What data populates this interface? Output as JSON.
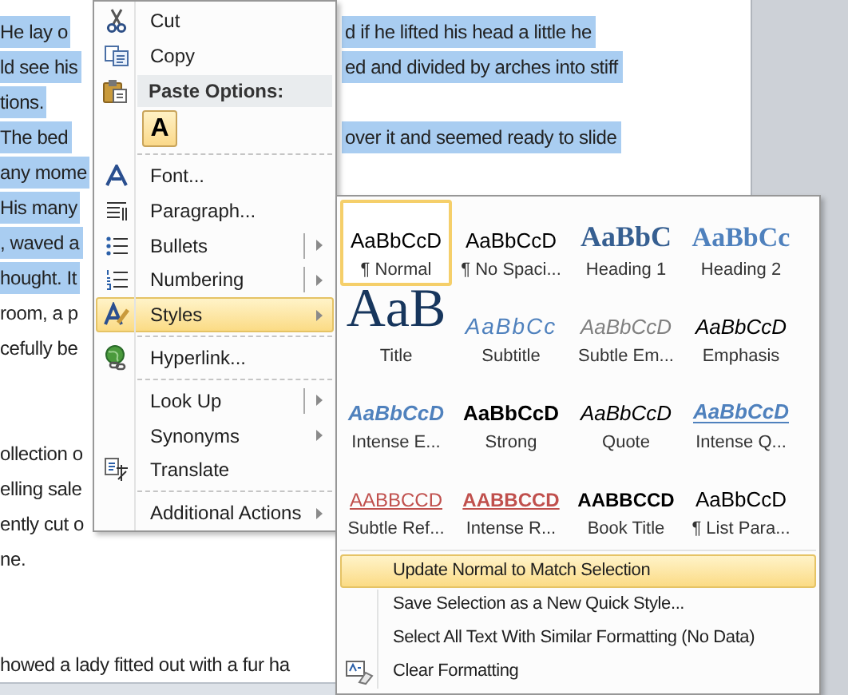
{
  "document": {
    "lines": [
      {
        "kind": "text",
        "left": "He lay o",
        "right": "d if he lifted his head a little he",
        "selected": true
      },
      {
        "kind": "text",
        "left": "ld see his",
        "right": "ed and divided by arches into stiff",
        "selected": true
      },
      {
        "kind": "text",
        "left": "tions.",
        "selected": true
      },
      {
        "kind": "text",
        "left": "The bed",
        "right": "over it and seemed ready to slide",
        "selected": true
      },
      {
        "kind": "text",
        "left": "any mome",
        "selected": true
      },
      {
        "kind": "text",
        "left": "His many",
        "selected": true
      },
      {
        "kind": "text",
        "left": ", waved a",
        "selected": true
      },
      {
        "kind": "text",
        "left": "hought. It",
        "selected": true
      },
      {
        "kind": "text",
        "left": "room, a p",
        "selected": false
      },
      {
        "kind": "text",
        "left": "cefully be",
        "selected": false
      },
      {
        "kind": "blank"
      },
      {
        "kind": "blank"
      },
      {
        "kind": "text",
        "left": "ollection o",
        "selected": false
      },
      {
        "kind": "text",
        "left": "elling sale",
        "selected": false
      },
      {
        "kind": "text",
        "left": "ently cut o",
        "selected": false
      },
      {
        "kind": "text",
        "left": "ne.",
        "selected": false
      },
      {
        "kind": "blank"
      },
      {
        "kind": "blank"
      },
      {
        "kind": "text",
        "left": "howed a lady fitted out with a fur ha",
        "selected": false
      }
    ]
  },
  "context_menu": {
    "items": [
      {
        "kind": "item",
        "label": "Cut",
        "submenu": false,
        "split": false,
        "selected": false
      },
      {
        "kind": "item",
        "label": "Copy",
        "submenu": false,
        "split": false,
        "selected": false
      },
      {
        "kind": "header",
        "label": "Paste Options:"
      },
      {
        "kind": "paste",
        "label": "A"
      },
      {
        "kind": "separator"
      },
      {
        "kind": "item",
        "label": "Font...",
        "submenu": false,
        "split": false,
        "selected": false
      },
      {
        "kind": "item",
        "label": "Paragraph...",
        "submenu": false,
        "split": false,
        "selected": false
      },
      {
        "kind": "item",
        "label": "Bullets",
        "submenu": true,
        "split": true,
        "selected": false
      },
      {
        "kind": "item",
        "label": "Numbering",
        "submenu": true,
        "split": true,
        "selected": false
      },
      {
        "kind": "item",
        "label": "Styles",
        "submenu": true,
        "split": false,
        "selected": true
      },
      {
        "kind": "separator"
      },
      {
        "kind": "item",
        "label": "Hyperlink...",
        "submenu": false,
        "split": false,
        "selected": false
      },
      {
        "kind": "separator"
      },
      {
        "kind": "item",
        "label": "Look Up",
        "submenu": true,
        "split": true,
        "selected": false
      },
      {
        "kind": "item",
        "label": "Synonyms",
        "submenu": true,
        "split": false,
        "selected": false
      },
      {
        "kind": "item",
        "label": "Translate",
        "submenu": false,
        "split": false,
        "selected": false
      },
      {
        "kind": "separator"
      },
      {
        "kind": "item",
        "label": "Additional Actions",
        "submenu": true,
        "split": false,
        "selected": false
      }
    ]
  },
  "styles_menu": {
    "gallery": [
      {
        "kind": "normal",
        "sample": "AaBbCcD",
        "label": "¶ Normal",
        "selected": true
      },
      {
        "kind": "normal",
        "sample": "AaBbCcD",
        "label": "¶ No Spaci...",
        "selected": false
      },
      {
        "kind": "heading1",
        "sample": "AaBbC",
        "label": "Heading 1",
        "selected": false
      },
      {
        "kind": "heading2",
        "sample": "AaBbCc",
        "label": "Heading 2",
        "selected": false
      },
      {
        "kind": "title",
        "sample": "AaB",
        "label": "Title",
        "selected": false
      },
      {
        "kind": "subtitle",
        "sample": "AaBbCc",
        "label": "Subtitle",
        "selected": false
      },
      {
        "kind": "subtle_emphasis",
        "sample": "AaBbCcD",
        "label": "Subtle Em...",
        "selected": false
      },
      {
        "kind": "emphasis",
        "sample": "AaBbCcD",
        "label": "Emphasis",
        "selected": false
      },
      {
        "kind": "intense_emphasis",
        "sample": "AaBbCcD",
        "label": "Intense E...",
        "selected": false
      },
      {
        "kind": "strong",
        "sample": "AaBbCcD",
        "label": "Strong",
        "selected": false
      },
      {
        "kind": "quote",
        "sample": "AaBbCcD",
        "label": "Quote",
        "selected": false
      },
      {
        "kind": "intense_quote",
        "sample": "AaBbCcD",
        "label": "Intense Q...",
        "selected": false
      },
      {
        "kind": "subtle_reference",
        "sample": "AABBCCD",
        "label": "Subtle Ref...",
        "selected": false
      },
      {
        "kind": "intense_reference",
        "sample": "AABBCCD",
        "label": "Intense R...",
        "selected": false
      },
      {
        "kind": "book_title",
        "sample": "AABBCCD",
        "label": "Book Title",
        "selected": false
      },
      {
        "kind": "normal",
        "sample": "AaBbCcD",
        "label": "¶ List Para...",
        "selected": false
      }
    ],
    "commands": [
      {
        "label": "Update Normal to Match Selection",
        "selected": true
      },
      {
        "label": "Save Selection as a New Quick Style...",
        "selected": false
      },
      {
        "label": "Select All Text With Similar Formatting (No Data)",
        "selected": false
      },
      {
        "label": "Clear Formatting",
        "selected": false
      }
    ]
  }
}
